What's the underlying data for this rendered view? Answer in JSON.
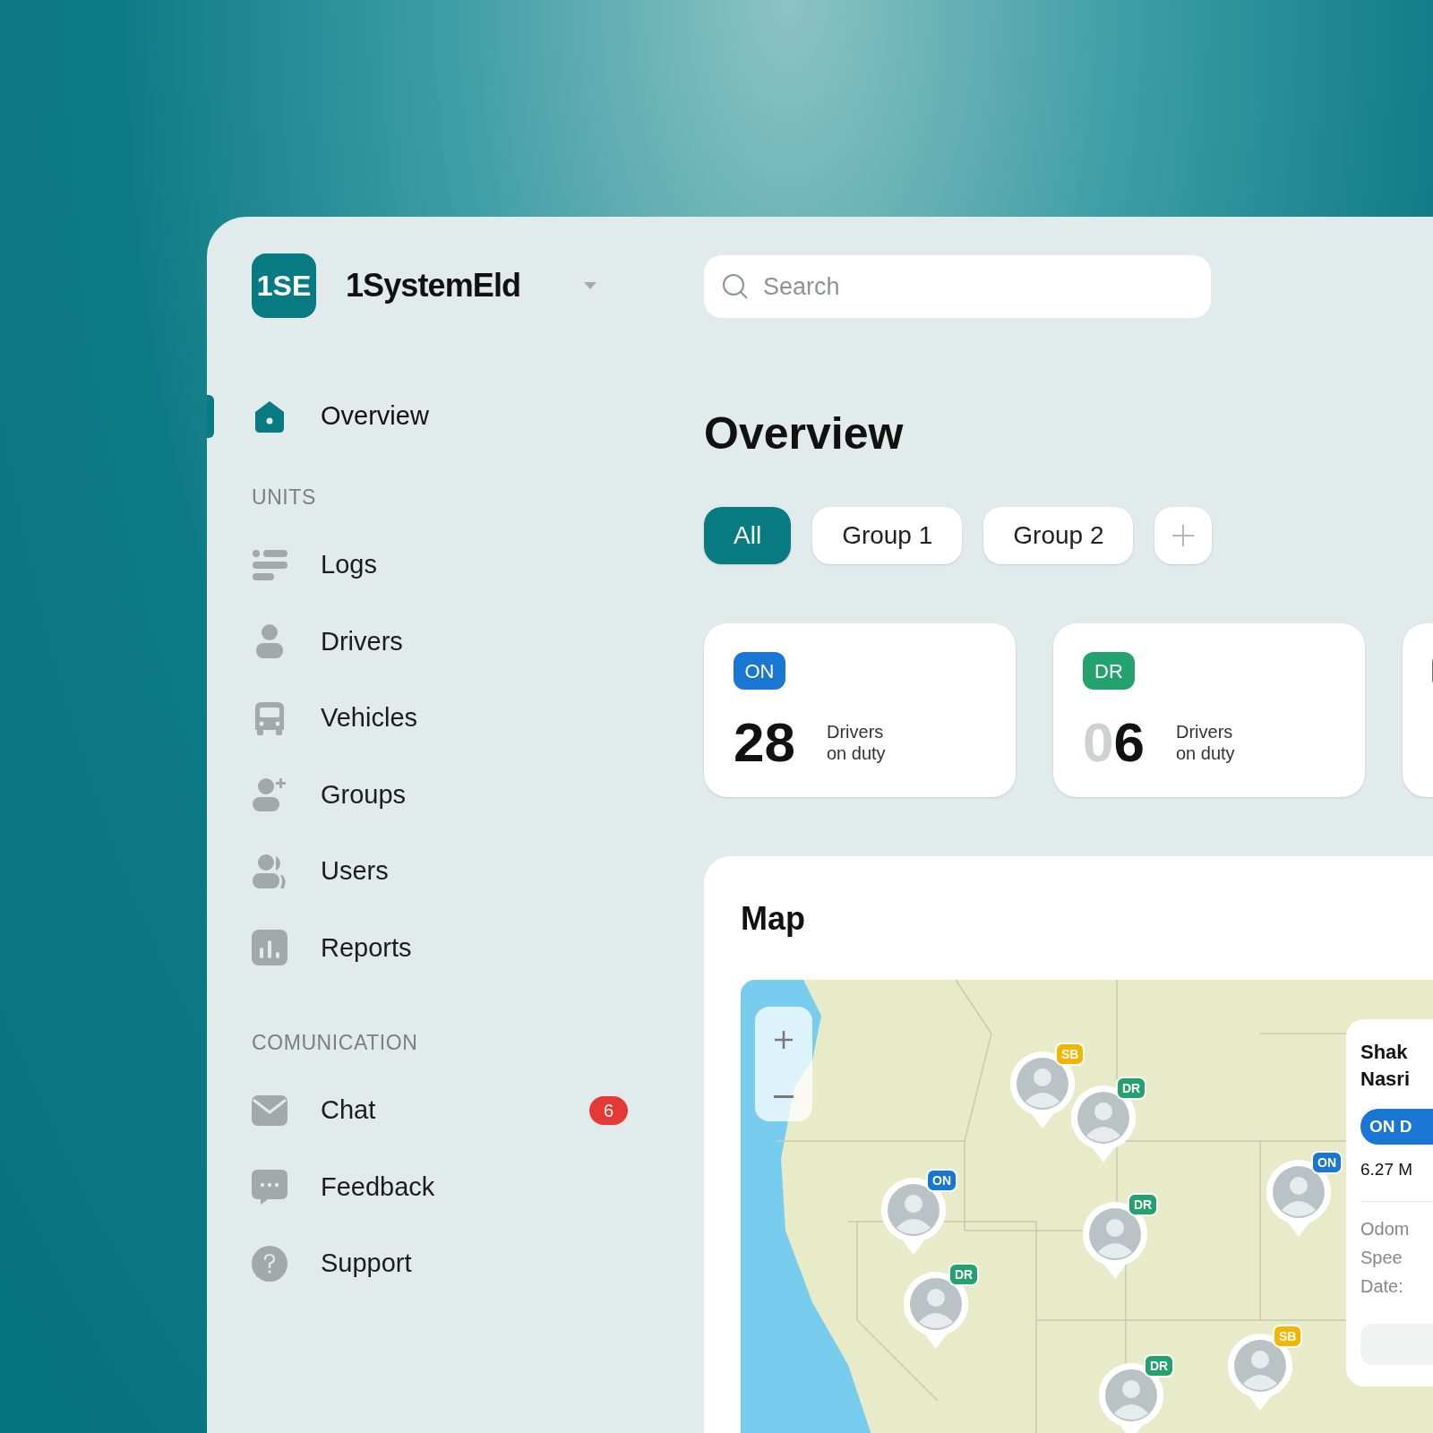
{
  "brand": {
    "logo": "1SE",
    "name": "1SystemEld"
  },
  "search": {
    "placeholder": "Search"
  },
  "nav": {
    "top": [
      {
        "label": "Overview",
        "selected": true
      }
    ],
    "sections": [
      {
        "heading": "UNITS",
        "items": [
          {
            "label": "Logs",
            "selected": false
          },
          {
            "label": "Drivers",
            "selected": false
          },
          {
            "label": "Vehicles",
            "selected": false
          },
          {
            "label": "Groups",
            "selected": false
          },
          {
            "label": "Users",
            "selected": false
          },
          {
            "label": "Reports",
            "selected": false
          }
        ]
      },
      {
        "heading": "COMUNICATION",
        "items": [
          {
            "label": "Chat",
            "selected": false,
            "count": "6"
          },
          {
            "label": "Feedback",
            "selected": false
          },
          {
            "label": "Support",
            "selected": false
          }
        ]
      }
    ]
  },
  "page_title": "Overview",
  "filters": [
    {
      "label": "All",
      "selected": true
    },
    {
      "label": "Group 1",
      "selected": false
    },
    {
      "label": "Group 2",
      "selected": false
    }
  ],
  "cards": [
    {
      "status": "ON",
      "color": "#1976d2",
      "number": "28",
      "label": "Drivers on duty"
    },
    {
      "status": "DR",
      "color": "#23a26d",
      "number_faded": "0",
      "number": "6",
      "label": "Drivers on duty"
    },
    {
      "color": "#6e6e6e"
    }
  ],
  "map": {
    "title": "Map",
    "pins": [
      {
        "status": "SB",
        "color": "#f5b400"
      },
      {
        "status": "DR",
        "color": "#23a26d"
      },
      {
        "status": "ON",
        "color": "#1976d2"
      },
      {
        "status": "DR",
        "color": "#23a26d"
      },
      {
        "status": "DR",
        "color": "#23a26d"
      },
      {
        "status": "ON",
        "color": "#1976d2"
      },
      {
        "status": "SB",
        "color": "#f5b400"
      },
      {
        "status": "DR",
        "color": "#23a26d"
      }
    ],
    "info": {
      "name_lines": [
        "Shak",
        "Nasri"
      ],
      "status": "ON D",
      "distance": "6.27 M",
      "fields": [
        "Odom",
        "Spee",
        "Date:"
      ]
    }
  }
}
